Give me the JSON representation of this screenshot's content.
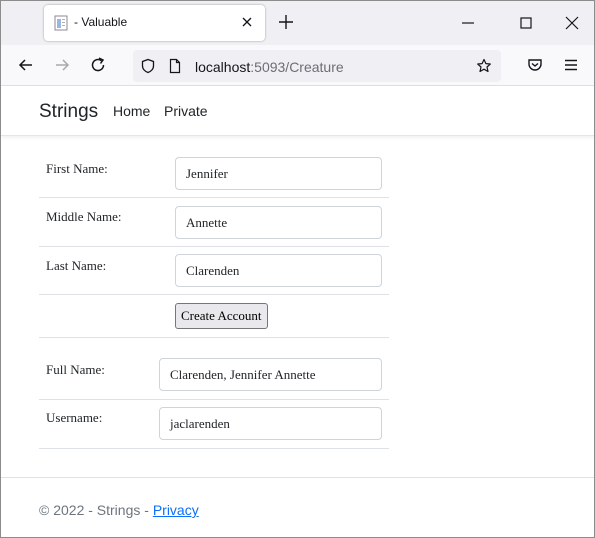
{
  "browser": {
    "tab_title": "- Valuable",
    "url_host": "localhost",
    "url_rest": ":5093/Creature"
  },
  "site": {
    "brand": "Strings",
    "nav": [
      {
        "label": "Home"
      },
      {
        "label": "Private"
      }
    ]
  },
  "form": {
    "first_name": {
      "label": "First Name:",
      "value": "Jennifer"
    },
    "middle_name": {
      "label": "Middle Name:",
      "value": "Annette"
    },
    "last_name": {
      "label": "Last Name:",
      "value": "Clarenden"
    },
    "create_button": "Create Account",
    "full_name": {
      "label": "Full Name:",
      "value": "Clarenden, Jennifer Annette"
    },
    "username": {
      "label": "Username:",
      "value": "jaclarenden"
    }
  },
  "footer": {
    "text": "© 2022 - Strings - ",
    "privacy_link": "Privacy"
  },
  "colors": {
    "link": "#0d6efd",
    "footer_text": "#6c757d",
    "tabstrip": "#f0f0f4"
  }
}
